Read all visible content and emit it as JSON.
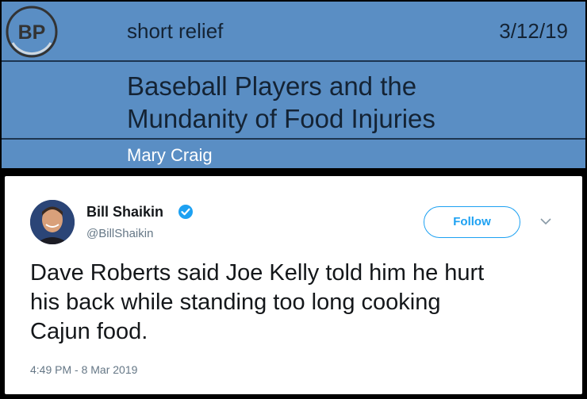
{
  "header": {
    "logo_text": "BP",
    "section_label": "short relief",
    "date": "3/12/19",
    "title_line1": "Baseball Players and the",
    "title_line2": "Mundanity of Food Injuries",
    "author": "Mary Craig",
    "band_color": "#5a8ec4"
  },
  "tweet": {
    "display_name": "Bill Shaikin",
    "handle": "@BillShaikin",
    "follow_label": "Follow",
    "text_line1": "Dave Roberts said Joe Kelly told him he hurt",
    "text_line2": "his back while standing too long cooking",
    "text_line3": "Cajun food.",
    "timestamp": "4:49 PM - 8 Mar 2019",
    "accent_color": "#1da1f2",
    "icons": [
      "verified-badge-icon",
      "chevron-down-icon"
    ]
  }
}
